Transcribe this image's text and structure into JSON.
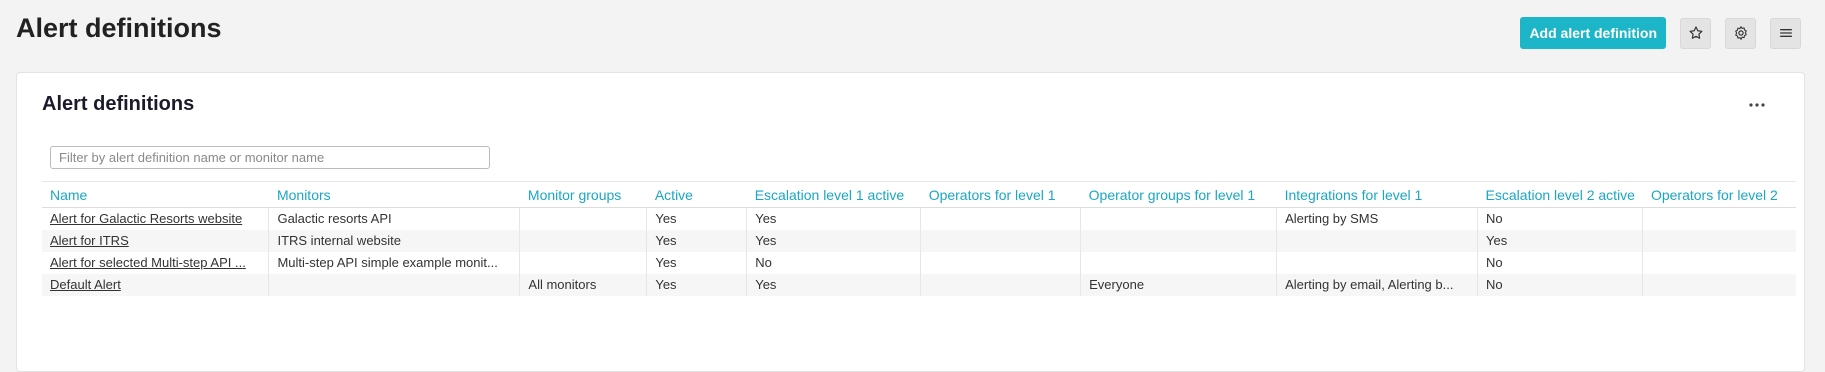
{
  "header": {
    "title": "Alert definitions",
    "add_button_label": "Add alert definition",
    "icons": [
      "star-icon",
      "gear-icon",
      "hamburger-menu-icon"
    ]
  },
  "card": {
    "title": "Alert definitions",
    "menu_icon": "ellipsis-icon",
    "filter_placeholder": "Filter by alert definition name or monitor name"
  },
  "table": {
    "columns": [
      "Name",
      "Monitors",
      "Monitor groups",
      "Active",
      "Escalation level 1 active",
      "Operators for level 1",
      "Operator groups for level 1",
      "Integrations for level 1",
      "Escalation level 2 active",
      "Operators for level 2"
    ],
    "rows": [
      [
        "Alert for Galactic Resorts website",
        "Galactic resorts API",
        "",
        "Yes",
        "Yes",
        "",
        "",
        "Alerting by SMS",
        "No",
        ""
      ],
      [
        "Alert for ITRS",
        "ITRS internal website",
        "",
        "Yes",
        "Yes",
        "",
        "",
        "",
        "Yes",
        ""
      ],
      [
        "Alert for selected Multi-step API ...",
        "Multi-step API simple example monit...",
        "",
        "Yes",
        "No",
        "",
        "",
        "",
        "No",
        ""
      ],
      [
        "Default Alert",
        "",
        "All monitors",
        "Yes",
        "Yes",
        "",
        "Everyone",
        "Alerting by email, Alerting b...",
        "No",
        ""
      ]
    ]
  },
  "colors": {
    "accent": "#1db6c8",
    "header_text": "#1aa7c4"
  }
}
